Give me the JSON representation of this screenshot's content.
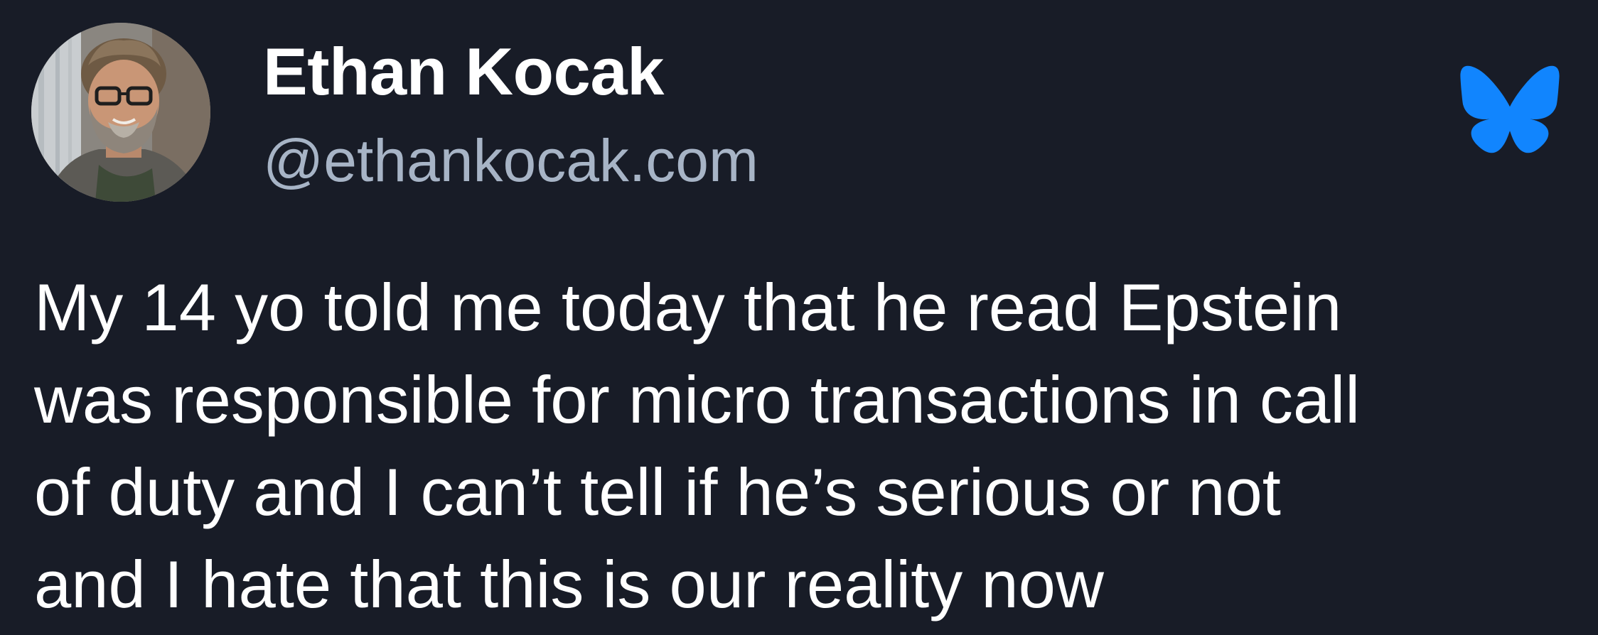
{
  "author": {
    "display_name": "Ethan Kocak",
    "handle": "@ethankocak.com",
    "avatar": "profile-photo"
  },
  "platform": {
    "icon": "bluesky-butterfly-icon",
    "color": "#1185fe"
  },
  "post": {
    "lines": [
      "My 14 yo told me today that he read Epstein",
      "was responsible for micro transactions in call",
      "of duty and I can’t tell if he’s serious or not",
      "and I hate that this is our reality now"
    ]
  },
  "colors": {
    "background": "#181c27",
    "text": "#ffffff",
    "handle": "#a7b4c6"
  }
}
